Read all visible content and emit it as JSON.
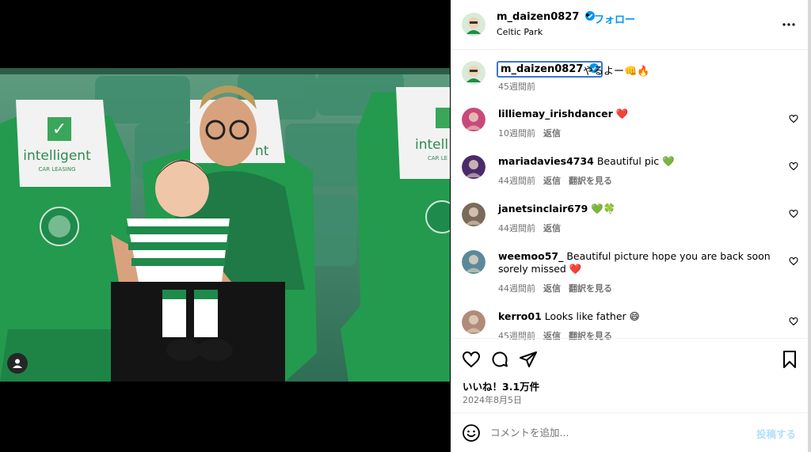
{
  "post": {
    "username": "m_daizen0827",
    "follow_label": "フォロー",
    "dot": "•",
    "location": "Celtic Park",
    "caption_user": "m_daizen0827",
    "caption_text": "やるよー👊🔥",
    "caption_time": "45週間前",
    "photo_text": {
      "sponsor_left": "intelligent",
      "sponsor_sub": "CAR LEASING",
      "sponsor_mid": "nt",
      "sponsor_right": "intell",
      "sponsor_right_sub": "CAR LE"
    }
  },
  "comments": [
    {
      "user": "lilliemay_irishdancer",
      "text": "❤️",
      "time": "10週間前",
      "reply": "返信",
      "translate": "",
      "avatar_color": "#c94a7a"
    },
    {
      "user": "mariadavies4734",
      "text": "Beautiful pic 💚",
      "time": "44週間前",
      "reply": "返信",
      "translate": "翻訳を見る",
      "avatar_color": "#4a2a6a"
    },
    {
      "user": "janetsinclair679",
      "text": "💚🍀",
      "time": "44週間前",
      "reply": "返信",
      "translate": "",
      "avatar_color": "#7a6a5a"
    },
    {
      "user": "weemoo57_",
      "text": "Beautiful picture hope you are back soon sorely missed ❤️",
      "time": "44週間前",
      "reply": "返信",
      "translate": "翻訳を見る",
      "avatar_color": "#5a8a9a"
    },
    {
      "user": "kerro01",
      "text": "Looks like father 😄",
      "time": "45週間前",
      "reply": "返信",
      "translate": "翻訳を見る",
      "avatar_color": "#b08a7a"
    }
  ],
  "stats": {
    "likes": "いいね！3.1万件",
    "date": "2024年8月5日"
  },
  "composer": {
    "placeholder": "コメントを追加...",
    "post_label": "投稿する"
  },
  "icons": {
    "more": "more-horizontal-icon",
    "like": "heart-icon",
    "comment": "comment-icon",
    "share": "share-icon",
    "save": "bookmark-icon",
    "emoji": "emoji-icon",
    "tag": "user-tag-icon"
  },
  "colors": {
    "accent": "#0095f6",
    "post_disabled": "#b2dffc",
    "verified": "#0095f6",
    "celtic_green": "#1e8a4c",
    "like_red": "#ed4956"
  }
}
